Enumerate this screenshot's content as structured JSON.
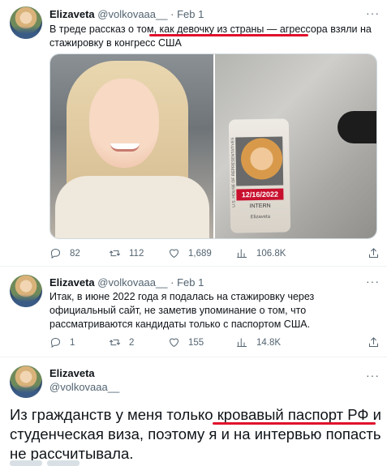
{
  "tweets": [
    {
      "name": "Elizaveta",
      "handle": "@volkovaaa__",
      "dot": "·",
      "date": "Feb 1",
      "more": "···",
      "text_before": "В треде рассказ о том, ",
      "text_highlight": "как девочку из страны — агрессора",
      "text_after": " взяли на стажировку в конгресс США",
      "badge": {
        "date": "12/16/2022",
        "role": "INTERN",
        "name": "Elizaveta",
        "vertical": "U.S. HOUSE OF REPRESENTATIVES"
      },
      "stats": {
        "replies": "82",
        "retweets": "112",
        "likes": "1,689",
        "views": "106.8K"
      }
    },
    {
      "name": "Elizaveta",
      "handle": "@volkovaaa__",
      "dot": "·",
      "date": "Feb 1",
      "more": "···",
      "text": "Итак, в июне 2022 года я подалась на стажировку через официальный сайт, не заметив упоминание о том, что рассматриваются кандидаты только с паспортом США.",
      "stats": {
        "replies": "1",
        "retweets": "2",
        "likes": "155",
        "views": "14.8K"
      }
    },
    {
      "name": "Elizaveta",
      "handle": "@volkovaaa__",
      "more": "···",
      "text_before": "Из гражданств у меня только ",
      "text_highlight": "кровавый паспорт РФ и",
      "text_after": " студенческая виза, поэтому я и на интервью попасть не рассчитывала."
    }
  ],
  "icons": {
    "reply": "reply-icon",
    "retweet": "retweet-icon",
    "like": "heart-icon",
    "views": "views-icon",
    "share": "share-icon"
  },
  "colors": {
    "underline": "#e0102b",
    "secondary_text": "#536471",
    "divider": "#eff3f4"
  }
}
